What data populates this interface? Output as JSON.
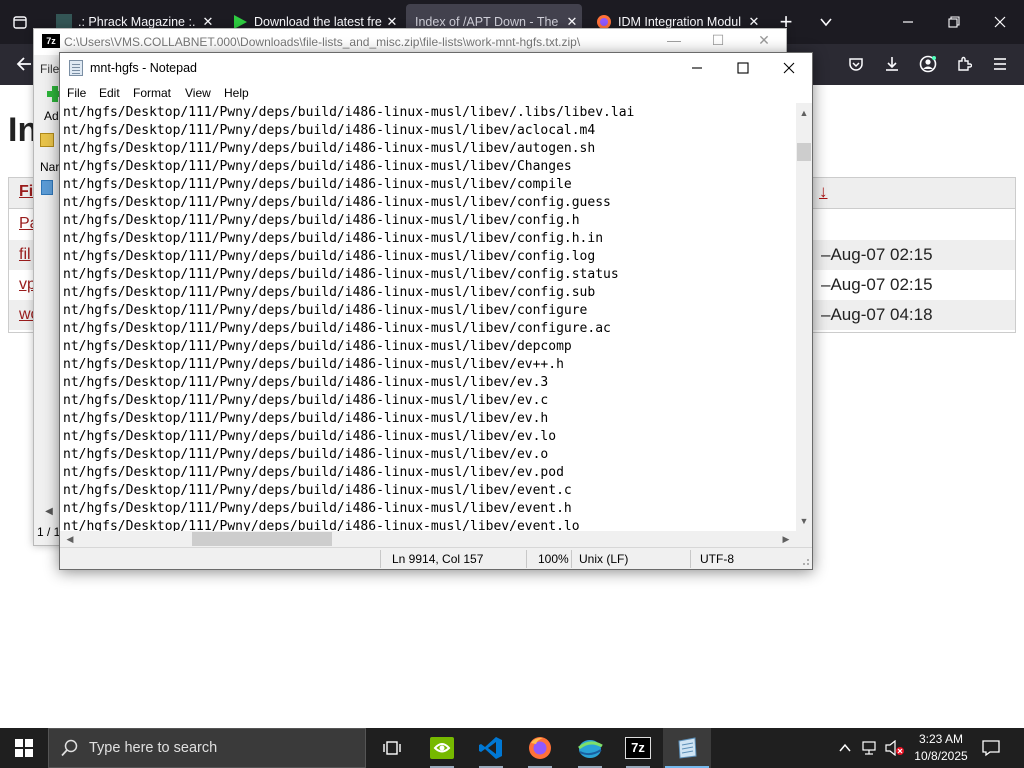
{
  "browser": {
    "tabs": [
      {
        "title": ".: Phrack Magazine :.",
        "active": false
      },
      {
        "title": "Download the latest fre",
        "active": false
      },
      {
        "title": "Index of /APT Down - The I",
        "active": true
      },
      {
        "title": "IDM Integration Modul",
        "active": false
      }
    ],
    "new_tab_symbol": "+",
    "close_symbol": "✕"
  },
  "webpage": {
    "heading": "In",
    "header_first_col": "Fi",
    "sort_arrow": "↓",
    "rows": [
      {
        "name": "Pa",
        "date": ""
      },
      {
        "name": "fil",
        "date": "–Aug-07 02:15"
      },
      {
        "name": "vp",
        "date": "–Aug-07 02:15"
      },
      {
        "name": "wo",
        "date": "–Aug-07 04:18"
      }
    ]
  },
  "zip": {
    "icon_label": "7z",
    "title": "C:\\Users\\VMS.COLLABNET.000\\Downloads\\file-lists_and_misc.zip\\file-lists\\work-mnt-hgfs.txt.zip\\",
    "menu_first": "File",
    "add_label": "Ad",
    "list_header": "Nar",
    "status": "1 / 1"
  },
  "notepad": {
    "title": "mnt-hgfs - Notepad",
    "menus": [
      "File",
      "Edit",
      "Format",
      "View",
      "Help"
    ],
    "lines": [
      "nt/hgfs/Desktop/111/Pwny/deps/build/i486-linux-musl/libev/.libs/libev.lai",
      "nt/hgfs/Desktop/111/Pwny/deps/build/i486-linux-musl/libev/aclocal.m4",
      "nt/hgfs/Desktop/111/Pwny/deps/build/i486-linux-musl/libev/autogen.sh",
      "nt/hgfs/Desktop/111/Pwny/deps/build/i486-linux-musl/libev/Changes",
      "nt/hgfs/Desktop/111/Pwny/deps/build/i486-linux-musl/libev/compile",
      "nt/hgfs/Desktop/111/Pwny/deps/build/i486-linux-musl/libev/config.guess",
      "nt/hgfs/Desktop/111/Pwny/deps/build/i486-linux-musl/libev/config.h",
      "nt/hgfs/Desktop/111/Pwny/deps/build/i486-linux-musl/libev/config.h.in",
      "nt/hgfs/Desktop/111/Pwny/deps/build/i486-linux-musl/libev/config.log",
      "nt/hgfs/Desktop/111/Pwny/deps/build/i486-linux-musl/libev/config.status",
      "nt/hgfs/Desktop/111/Pwny/deps/build/i486-linux-musl/libev/config.sub",
      "nt/hgfs/Desktop/111/Pwny/deps/build/i486-linux-musl/libev/configure",
      "nt/hgfs/Desktop/111/Pwny/deps/build/i486-linux-musl/libev/configure.ac",
      "nt/hgfs/Desktop/111/Pwny/deps/build/i486-linux-musl/libev/depcomp",
      "nt/hgfs/Desktop/111/Pwny/deps/build/i486-linux-musl/libev/ev++.h",
      "nt/hgfs/Desktop/111/Pwny/deps/build/i486-linux-musl/libev/ev.3",
      "nt/hgfs/Desktop/111/Pwny/deps/build/i486-linux-musl/libev/ev.c",
      "nt/hgfs/Desktop/111/Pwny/deps/build/i486-linux-musl/libev/ev.h",
      "nt/hgfs/Desktop/111/Pwny/deps/build/i486-linux-musl/libev/ev.lo",
      "nt/hgfs/Desktop/111/Pwny/deps/build/i486-linux-musl/libev/ev.o",
      "nt/hgfs/Desktop/111/Pwny/deps/build/i486-linux-musl/libev/ev.pod",
      "nt/hgfs/Desktop/111/Pwny/deps/build/i486-linux-musl/libev/event.c",
      "nt/hgfs/Desktop/111/Pwny/deps/build/i486-linux-musl/libev/event.h",
      "nt/hgfs/Desktop/111/Pwny/deps/build/i486-linux-musl/libev/event.lo"
    ],
    "status": {
      "position": "Ln 9914, Col 157",
      "zoom": "100%",
      "line_endings": "Unix (LF)",
      "encoding": "UTF-8"
    }
  },
  "taskbar": {
    "search_placeholder": "Type here to search",
    "seven_zip_label": "7z",
    "clock_time": "3:23 AM",
    "clock_date": "10/8/2025"
  },
  "colors": {
    "firefox_dark": "#1c1b22",
    "link_red": "#9a1c1c",
    "taskbar": "#1f1f1f",
    "nvidia_green": "#76b900",
    "vscode_blue": "#0078d4"
  }
}
